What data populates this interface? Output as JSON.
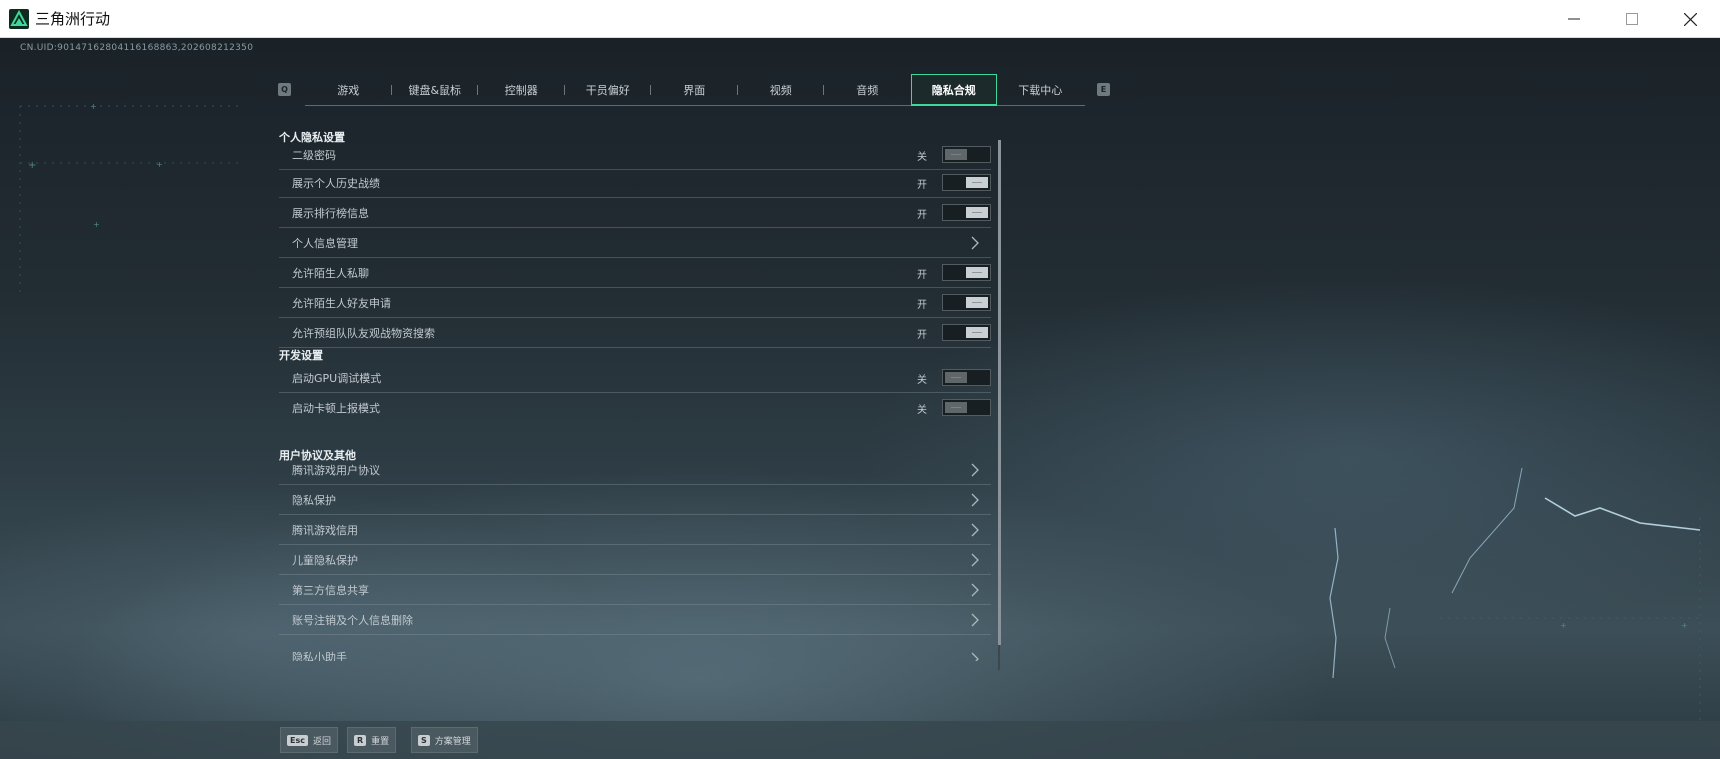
{
  "window": {
    "title": "三角洲行动",
    "minimize_icon": "minimize-icon",
    "maximize_icon": "maximize-icon",
    "close_icon": "close-icon"
  },
  "uid": "CN.UID:9014716280411616886З,202608212350",
  "tab_key_left": "Q",
  "tab_key_right": "E",
  "tabs": [
    {
      "label": "游戏",
      "active": false
    },
    {
      "label": "键盘&鼠标",
      "active": false
    },
    {
      "label": "控制器",
      "active": false
    },
    {
      "label": "干员偏好",
      "active": false
    },
    {
      "label": "界面",
      "active": false
    },
    {
      "label": "视频",
      "active": false
    },
    {
      "label": "音频",
      "active": false
    },
    {
      "label": "隐私合规",
      "active": true
    },
    {
      "label": "下载中心",
      "active": false
    }
  ],
  "sections": {
    "privacy": {
      "title": "个人隐私设置",
      "rows": [
        {
          "label": "二级密码",
          "state": "关",
          "type": "toggle",
          "on": false
        },
        {
          "label": "展示个人历史战绩",
          "state": "开",
          "type": "toggle",
          "on": true
        },
        {
          "label": "展示排行榜信息",
          "state": "开",
          "type": "toggle",
          "on": true
        },
        {
          "label": "个人信息管理",
          "type": "link"
        },
        {
          "label": "允许陌生人私聊",
          "state": "开",
          "type": "toggle",
          "on": true
        },
        {
          "label": "允许陌生人好友申请",
          "state": "开",
          "type": "toggle",
          "on": true
        },
        {
          "label": "允许预组队队友观战物资搜索",
          "state": "开",
          "type": "toggle",
          "on": true
        }
      ]
    },
    "dev": {
      "title": "开发设置",
      "rows": [
        {
          "label": "启动GPU调试模式",
          "state": "关",
          "type": "toggle",
          "on": false
        },
        {
          "label": "启动卡顿上报模式",
          "state": "关",
          "type": "toggle",
          "on": false
        }
      ]
    },
    "agreements": {
      "title": "用户协议及其他",
      "rows": [
        {
          "label": "腾讯游戏用户协议",
          "type": "link"
        },
        {
          "label": "隐私保护",
          "type": "link"
        },
        {
          "label": "腾讯游戏信用",
          "type": "link"
        },
        {
          "label": "儿童隐私保护",
          "type": "link"
        },
        {
          "label": "第三方信息共享",
          "type": "link"
        },
        {
          "label": "账号注销及个人信息删除",
          "type": "link"
        },
        {
          "label": "隐私小助手",
          "type": "link"
        }
      ]
    }
  },
  "bottom_bar": [
    {
      "key": "Esc",
      "label": "返回"
    },
    {
      "key": "R",
      "label": "重置"
    },
    {
      "key": "S",
      "label": "方案管理"
    }
  ],
  "colors": {
    "accent": "#3fd79a",
    "background": "#222d33"
  }
}
